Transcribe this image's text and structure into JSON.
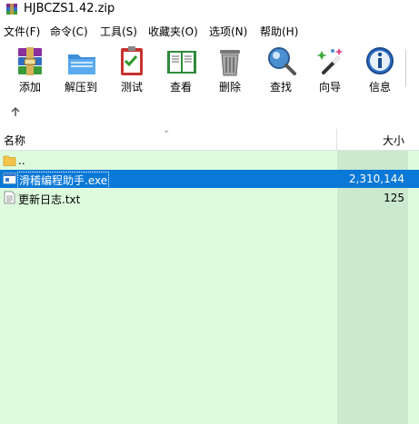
{
  "window": {
    "title": "HJBCZS1.42.zip"
  },
  "menu": [
    "文件(F)",
    "命令(C)",
    "工具(S)",
    "收藏夹(O)",
    "选项(N)",
    "帮助(H)"
  ],
  "toolbar": {
    "add": "添加",
    "extract": "解压到",
    "test": "测试",
    "view": "查看",
    "delete": "删除",
    "find": "查找",
    "wizard": "向导",
    "info": "信息"
  },
  "nav": {
    "up_icon": "up-arrow-icon"
  },
  "columns": {
    "name": "名称",
    "size": "大小"
  },
  "files": [
    {
      "name": "..",
      "size": "",
      "icon": "folder-icon",
      "selected": false
    },
    {
      "name": "滑稽编程助手.exe",
      "size": "2,310,144",
      "icon": "exe-file-icon",
      "selected": true
    },
    {
      "name": "更新日志.txt",
      "size": "125",
      "icon": "text-file-icon",
      "selected": false
    }
  ],
  "colors": {
    "selection": "#0a78d7",
    "list_bg": "#ddfadd",
    "size_col_bg": "#cbe9cf"
  }
}
